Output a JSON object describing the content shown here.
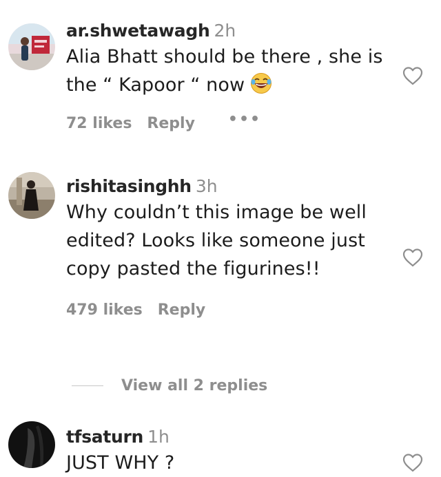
{
  "comments": [
    {
      "username": "ar.shwetawagh",
      "time": "2h",
      "text": "Alia Bhatt should be there , she is the “ Kapoor “ now",
      "emoji": "laughing-tears-emoji",
      "likes": "72 likes",
      "reply_label": "Reply",
      "more": "•••"
    },
    {
      "username": "rishitasinghh",
      "time": "3h",
      "text": "Why couldn’t this image be well edited? Looks like someone just copy pasted the figurines!!",
      "likes": "479 likes",
      "reply_label": "Reply"
    },
    {
      "username": "tfsaturn",
      "time": "1h",
      "text": "JUST WHY ?"
    }
  ],
  "view_replies": "View all 2 replies",
  "icons": {
    "heart": "heart-outline-icon",
    "more": "more-horizontal-icon"
  },
  "colors": {
    "text": "#1c1c1c",
    "muted": "#8e8e8e",
    "background": "#ffffff"
  }
}
